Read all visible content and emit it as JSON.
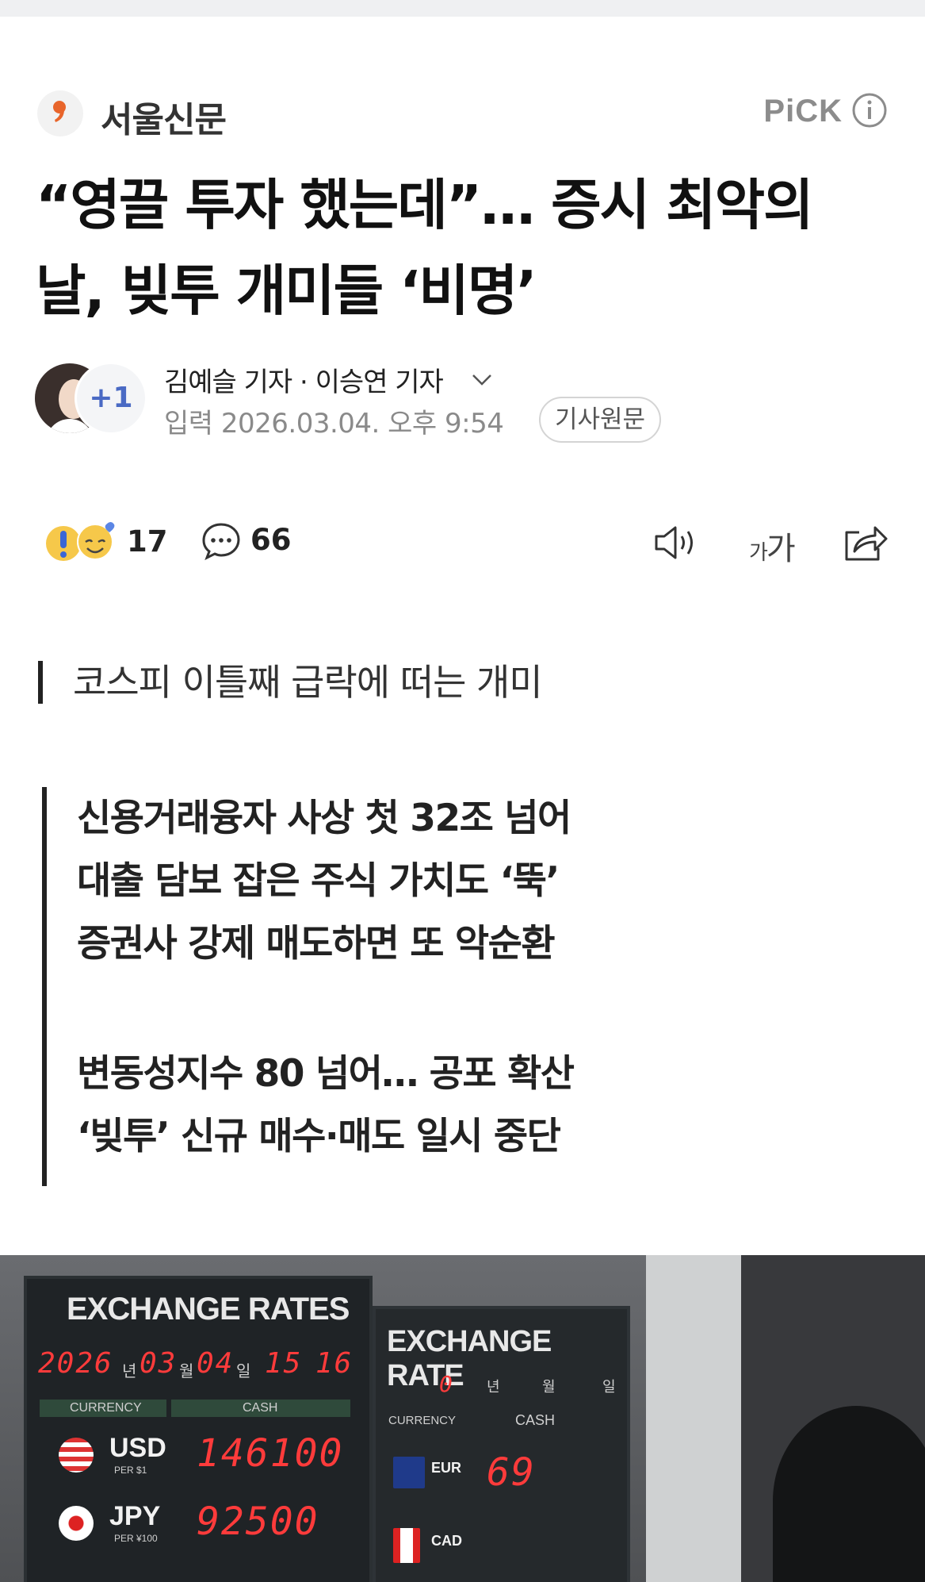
{
  "press": {
    "name": "서울신문",
    "pick_label": "PiCK"
  },
  "article": {
    "headline_line1": "“영끌 투자 했는데”… 증시 최악의",
    "headline_line2": "날, 빚투 개미들 ‘비명’",
    "reporters": "김예슬 기자 · 이승연 기자",
    "extra_reporters": "+1",
    "date": "입력 2026.03.04. 오후 9:54",
    "origin_button": "기사원문",
    "subtitle": "코스피 이틀째 급락에 떠는 개미",
    "summary": [
      "신용거래융자 사상 첫 32조 넘어",
      "대출 담보 잡은 주식 가치도 ‘뚝’",
      "증권사 강제 매도하면 또 악순환",
      "변동성지수 80 넘어… 공포 확산",
      "‘빚투’ 신규 매수·매도 일시 중단"
    ]
  },
  "actions": {
    "reaction_count": "17",
    "comment_count": "66",
    "font_size_label_small": "가",
    "font_size_label_large": "가"
  },
  "photo": {
    "board1_title": "EXCHANGE RATES",
    "board1_year": "2026",
    "board1_year_unit": "년",
    "board1_month": "03",
    "board1_month_unit": "월",
    "board1_day": "04",
    "board1_day_unit": "일",
    "board1_hour": "15",
    "board1_minute": "16",
    "board1_currency_header": "CURRENCY",
    "board1_cash_header": "CASH",
    "usd_code": "USD",
    "usd_per": "PER $1",
    "usd_rate": "146100",
    "jpy_code": "JPY",
    "jpy_per": "PER ¥100",
    "jpy_rate": "92500",
    "board2_title": "EXCHANGE RATE",
    "board2_zero": "0",
    "board2_year_unit": "년",
    "board2_month_unit": "월",
    "board2_day_unit": "일",
    "board2_currency_header": "CURRENCY",
    "board2_cash_header": "CASH",
    "eur_code": "EUR",
    "eur_rate": "69",
    "cad_code": "CAD"
  },
  "colors": {
    "accent_blue": "#4a6ac4",
    "press_comma": "#e8652b",
    "led_red": "#ff3b3b"
  }
}
